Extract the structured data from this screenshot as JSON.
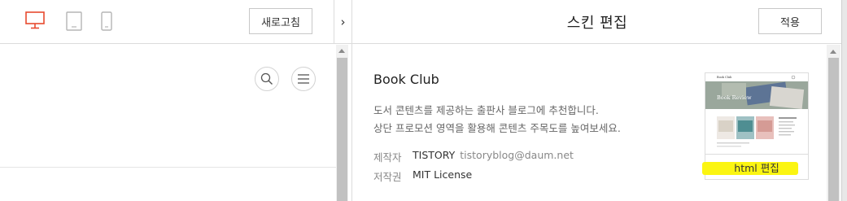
{
  "toolbar": {
    "refresh_label": "새로고침",
    "devices": [
      "desktop-icon",
      "tablet-icon",
      "mobile-icon"
    ],
    "active_device": "desktop",
    "active_color": "#e84a2f"
  },
  "preview": {
    "icons": [
      "search-icon",
      "menu-icon"
    ]
  },
  "collapse_label": "›",
  "editor": {
    "title": "스킨 편집",
    "apply_label": "적용",
    "skin": {
      "name": "Book Club",
      "desc_line1": "도서 콘텐츠를 제공하는 출판사 블로그에 추천합니다.",
      "desc_line2": "상단 프로모션 영역을 활용해 콘텐츠 주목도를 높여보세요.",
      "author_label": "제작자",
      "author": "TISTORY",
      "author_email": "tistoryblog@daum.net",
      "license_label": "저작권",
      "license": "MIT License"
    },
    "thumbnail": {
      "brand": "Book Club",
      "banner": "Book Review",
      "html_edit_label": "html 편집",
      "highlight_color": "#fbf511"
    }
  }
}
